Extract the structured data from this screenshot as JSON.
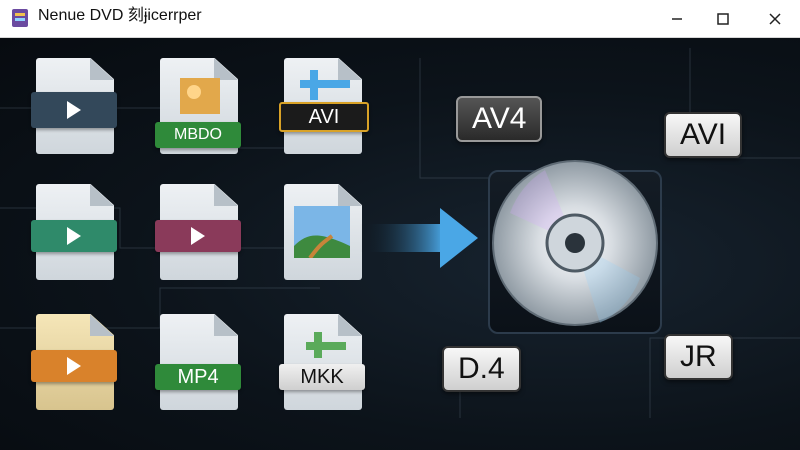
{
  "window": {
    "title": "Nenue DVD 刻ɉicerrper",
    "controls": {
      "minimize_icon": "minimize-icon",
      "maximize_icon": "maximize-icon",
      "close_icon": "close-icon"
    }
  },
  "file_icons": [
    {
      "label": "",
      "color": "#3a4a5a"
    },
    {
      "label": "MBDO",
      "color": "#2f8a3a"
    },
    {
      "label": "AVI",
      "color": "#222222"
    },
    {
      "label": "",
      "color": "#2f8a6a"
    },
    {
      "label": "",
      "color": "#8a3a5a"
    },
    {
      "label": "",
      "color": "#2b5d8c"
    },
    {
      "label": "",
      "color": "#d9822b"
    },
    {
      "label": "MP4",
      "color": "#2f8a3a"
    },
    {
      "label": "MKK",
      "color": "#d0d0d0"
    }
  ],
  "format_badges": {
    "top_left": "AV4",
    "top_right": "AVI",
    "bottom_left": "D.4",
    "bottom_right": "JR"
  },
  "colors": {
    "accent_blue": "#4aa7e6",
    "disc_silver": "#d8dde2"
  }
}
